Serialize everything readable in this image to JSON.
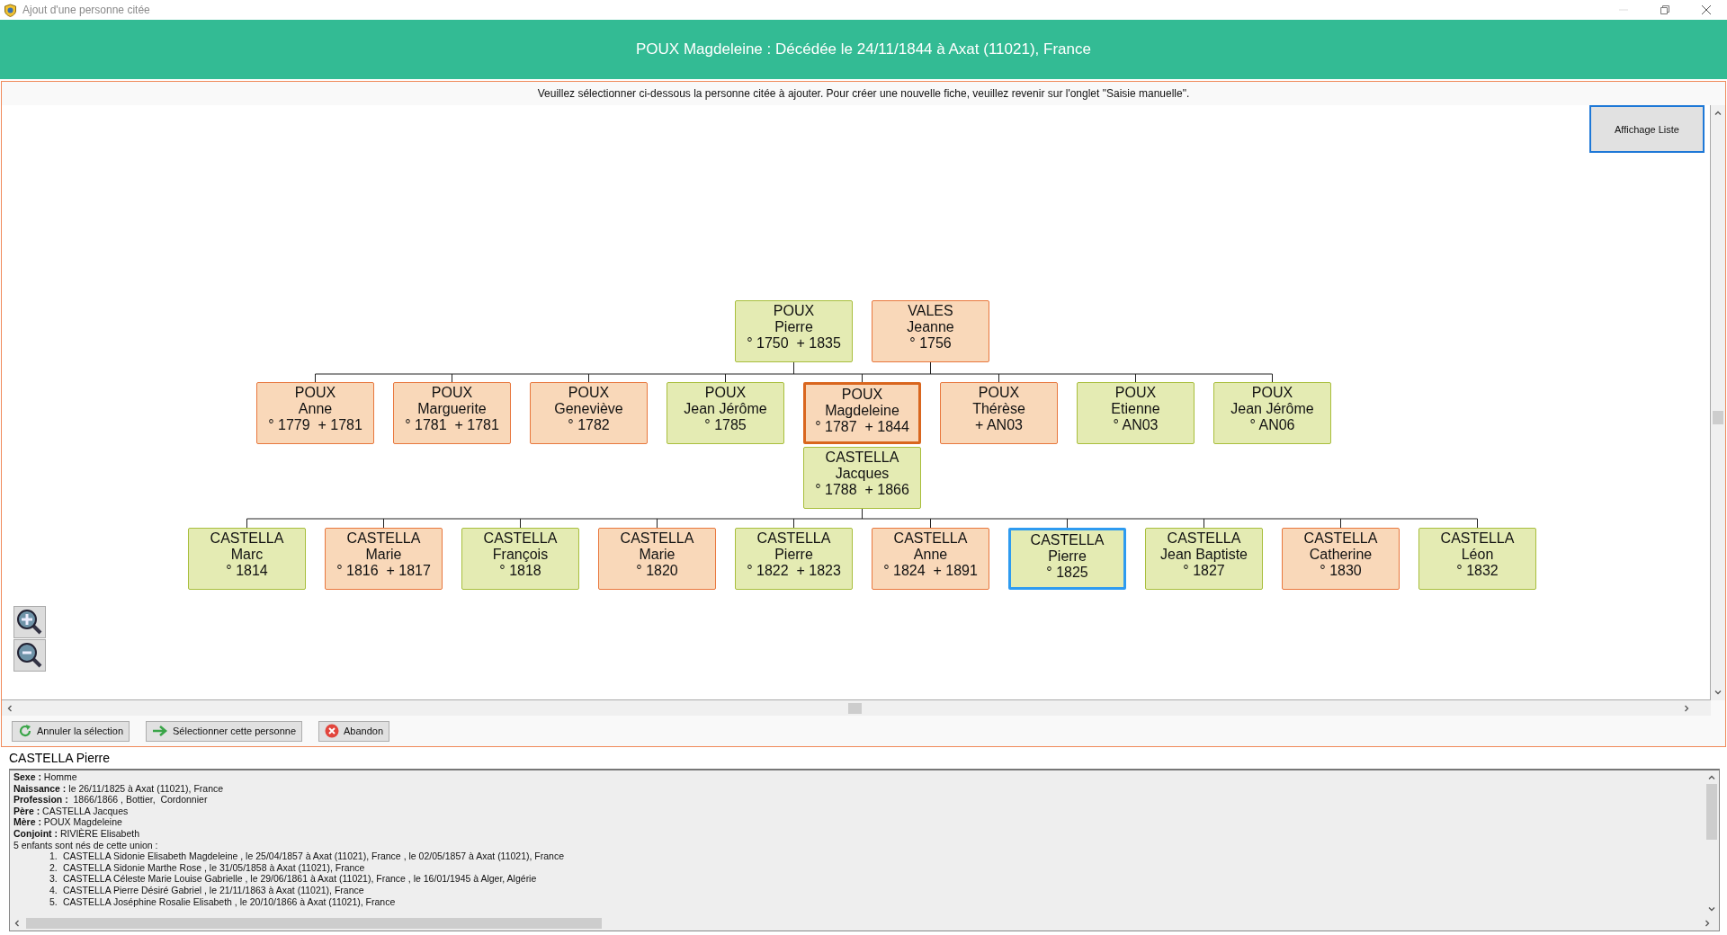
{
  "window": {
    "title": "Ajout d'une personne citée"
  },
  "header": {
    "title": "POUX Magdeleine : Décédée le 24/11/1844 à Axat (11021), France"
  },
  "instruction": "Veuillez sélectionner ci-dessous la personne citée à ajouter. Pour créer une nouvelle fiche, veuillez revenir sur l'onglet \"Saisie manuelle\".",
  "view_button": "Affichage Liste",
  "tree": {
    "parents": [
      {
        "surname": "POUX",
        "given": "Pierre",
        "dates": "° 1750  + 1835",
        "kind": "male",
        "selected": false,
        "focused": false
      },
      {
        "surname": "VALES",
        "given": "Jeanne",
        "dates": "° 1756",
        "kind": "female",
        "selected": false,
        "focused": false
      }
    ],
    "siblings": [
      {
        "surname": "POUX",
        "given": "Anne",
        "dates": "° 1779  + 1781",
        "kind": "female",
        "selected": false,
        "focused": false
      },
      {
        "surname": "POUX",
        "given": "Marguerite",
        "dates": "° 1781  + 1781",
        "kind": "female",
        "selected": false,
        "focused": false
      },
      {
        "surname": "POUX",
        "given": "Geneviève",
        "dates": "° 1782",
        "kind": "female",
        "selected": false,
        "focused": false
      },
      {
        "surname": "POUX",
        "given": "Jean Jérôme",
        "dates": "° 1785",
        "kind": "male",
        "selected": false,
        "focused": false
      },
      {
        "surname": "POUX",
        "given": "Magdeleine",
        "dates": "° 1787  + 1844",
        "kind": "female",
        "selected": false,
        "focused": true
      },
      {
        "surname": "POUX",
        "given": "Thérèse",
        "dates": "+ AN03",
        "kind": "female",
        "selected": false,
        "focused": false
      },
      {
        "surname": "POUX",
        "given": "Etienne",
        "dates": "° AN03",
        "kind": "male",
        "selected": false,
        "focused": false
      },
      {
        "surname": "POUX",
        "given": "Jean Jérôme",
        "dates": "° AN06",
        "kind": "male",
        "selected": false,
        "focused": false
      }
    ],
    "spouse": {
      "surname": "CASTELLA",
      "given": "Jacques",
      "dates": "° 1788  + 1866",
      "kind": "male",
      "selected": false,
      "focused": false
    },
    "children": [
      {
        "surname": "CASTELLA",
        "given": "Marc",
        "dates": "° 1814",
        "kind": "male",
        "selected": false,
        "focused": false
      },
      {
        "surname": "CASTELLA",
        "given": "Marie",
        "dates": "° 1816  + 1817",
        "kind": "female",
        "selected": false,
        "focused": false
      },
      {
        "surname": "CASTELLA",
        "given": "François",
        "dates": "° 1818",
        "kind": "male",
        "selected": false,
        "focused": false
      },
      {
        "surname": "CASTELLA",
        "given": "Marie",
        "dates": "° 1820",
        "kind": "female",
        "selected": false,
        "focused": false
      },
      {
        "surname": "CASTELLA",
        "given": "Pierre",
        "dates": "° 1822  + 1823",
        "kind": "male",
        "selected": false,
        "focused": false
      },
      {
        "surname": "CASTELLA",
        "given": "Anne",
        "dates": "° 1824  + 1891",
        "kind": "female",
        "selected": false,
        "focused": false
      },
      {
        "surname": "CASTELLA",
        "given": "Pierre",
        "dates": "° 1825",
        "kind": "male",
        "selected": true,
        "focused": false
      },
      {
        "surname": "CASTELLA",
        "given": "Jean Baptiste",
        "dates": "° 1827",
        "kind": "male",
        "selected": false,
        "focused": false
      },
      {
        "surname": "CASTELLA",
        "given": "Catherine",
        "dates": "° 1830",
        "kind": "female",
        "selected": false,
        "focused": false
      },
      {
        "surname": "CASTELLA",
        "given": "Léon",
        "dates": "° 1832",
        "kind": "male",
        "selected": false,
        "focused": false
      }
    ]
  },
  "actions": [
    {
      "label": "Annuler la sélection",
      "kind": "undo"
    },
    {
      "label": "Sélectionner cette personne",
      "kind": "select"
    },
    {
      "label": "Abandon",
      "kind": "cancel"
    }
  ],
  "details": {
    "title": "CASTELLA Pierre",
    "lines": [
      "**Sexe :** Homme",
      "**Naissance :** le 26/11/1825 à Axat (11021), France",
      "**Profession :**  1866/1866 , Bottier,  Cordonnier",
      "**Père :** CASTELLA Jacques",
      "**Mère :** POUX Magdeleine",
      "**Conjoint :** RIVIÈRE Elisabeth",
      "5 enfants sont nés de cette union :"
    ],
    "offspring": [
      {
        "number": "1.",
        "text": "CASTELLA Sidonie Elisabeth Magdeleine , le 25/04/1857 à Axat (11021), France , le 02/05/1857 à Axat (11021), France"
      },
      {
        "number": "2.",
        "text": "CASTELLA Sidonie Marthe Rose , le 31/05/1858 à Axat (11021), France"
      },
      {
        "number": "3.",
        "text": "CASTELLA Céleste Marie Louise Gabrielle , le 29/06/1861 à Axat (11021), France , le 16/01/1945 à Alger, Algérie"
      },
      {
        "number": "4.",
        "text": "CASTELLA Pierre Désiré Gabriel , le 21/11/1863 à Axat (11021), France"
      },
      {
        "number": "5.",
        "text": "CASTELLA Joséphine Rosalie Elisabeth , le 20/10/1866 à Axat (11021), France"
      }
    ]
  }
}
